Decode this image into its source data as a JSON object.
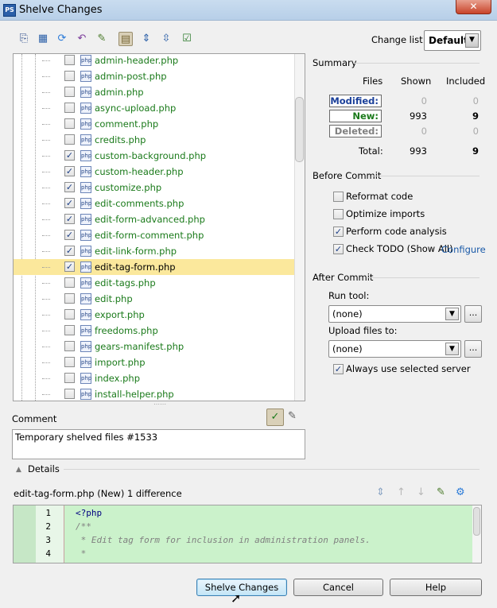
{
  "window": {
    "title": "Shelve Changes",
    "close_glyph": "✕"
  },
  "toolbar": {
    "icons": [
      "diff-icon",
      "group-icon",
      "refresh-icon",
      "revert-icon",
      "edit-source-icon",
      "group-by-dir-icon",
      "expand-all-icon",
      "collapse-all-icon",
      "select-all-icon"
    ],
    "changelist_label": "Change list:",
    "changelist_value": "Default"
  },
  "files": [
    {
      "name": "admin-header.php",
      "checked": false
    },
    {
      "name": "admin-post.php",
      "checked": false
    },
    {
      "name": "admin.php",
      "checked": false
    },
    {
      "name": "async-upload.php",
      "checked": false
    },
    {
      "name": "comment.php",
      "checked": false
    },
    {
      "name": "credits.php",
      "checked": false
    },
    {
      "name": "custom-background.php",
      "checked": true
    },
    {
      "name": "custom-header.php",
      "checked": true
    },
    {
      "name": "customize.php",
      "checked": true
    },
    {
      "name": "edit-comments.php",
      "checked": true
    },
    {
      "name": "edit-form-advanced.php",
      "checked": true
    },
    {
      "name": "edit-form-comment.php",
      "checked": true
    },
    {
      "name": "edit-link-form.php",
      "checked": true
    },
    {
      "name": "edit-tag-form.php",
      "checked": true,
      "selected": true
    },
    {
      "name": "edit-tags.php",
      "checked": false
    },
    {
      "name": "edit.php",
      "checked": false
    },
    {
      "name": "export.php",
      "checked": false
    },
    {
      "name": "freedoms.php",
      "checked": false
    },
    {
      "name": "gears-manifest.php",
      "checked": false
    },
    {
      "name": "import.php",
      "checked": false
    },
    {
      "name": "index.php",
      "checked": false
    },
    {
      "name": "install-helper.php",
      "checked": false
    }
  ],
  "file_icon_text": "php",
  "summary": {
    "heading": "Summary",
    "col_files": "Files",
    "col_shown": "Shown",
    "col_included": "Included",
    "rows": [
      {
        "label": "Modified:",
        "color": "#1a3f99",
        "shown": "0",
        "included": "0"
      },
      {
        "label": "New:",
        "color": "#1a7a1a",
        "shown": "993",
        "included": "9"
      },
      {
        "label": "Deleted:",
        "color": "#808080",
        "shown": "0",
        "included": "0"
      }
    ],
    "total_label": "Total:",
    "total_shown": "993",
    "total_included": "9"
  },
  "before_commit": {
    "heading": "Before Commit",
    "options": [
      {
        "label": "Reformat code",
        "checked": false
      },
      {
        "label": "Optimize imports",
        "checked": false
      },
      {
        "label": "Perform code analysis",
        "checked": true
      },
      {
        "label": "Check TODO (Show All)",
        "checked": true
      }
    ],
    "configure_link": "Configure"
  },
  "after_commit": {
    "heading": "After Commit",
    "run_tool_label": "Run tool:",
    "run_tool_value": "(none)",
    "upload_label": "Upload files to:",
    "upload_value": "(none)",
    "browse_glyph": "...",
    "always_use_label": "Always use selected server",
    "always_use_checked": true
  },
  "comment": {
    "label": "Comment",
    "value": "Temporary shelved files #1533"
  },
  "details": {
    "label": "Details",
    "file_info": "edit-tag-form.php (New) 1 difference"
  },
  "code": {
    "lines": [
      {
        "num": "1",
        "text": "<?php",
        "color": "#000080",
        "italic": false
      },
      {
        "num": "2",
        "text": "/**",
        "color": "#808080",
        "italic": true
      },
      {
        "num": "3",
        "text": " * Edit tag form for inclusion in administration panels.",
        "color": "#808080",
        "italic": true
      },
      {
        "num": "4",
        "text": " *",
        "color": "#808080",
        "italic": true
      }
    ]
  },
  "buttons": {
    "shelve": "Shelve Changes",
    "cancel": "Cancel",
    "help": "Help"
  },
  "colors": {
    "selected_row": "#fbe89c",
    "file_green": "#1a7a1a",
    "code_bg": "#cbf2cb",
    "link": "#1a5aa8"
  }
}
